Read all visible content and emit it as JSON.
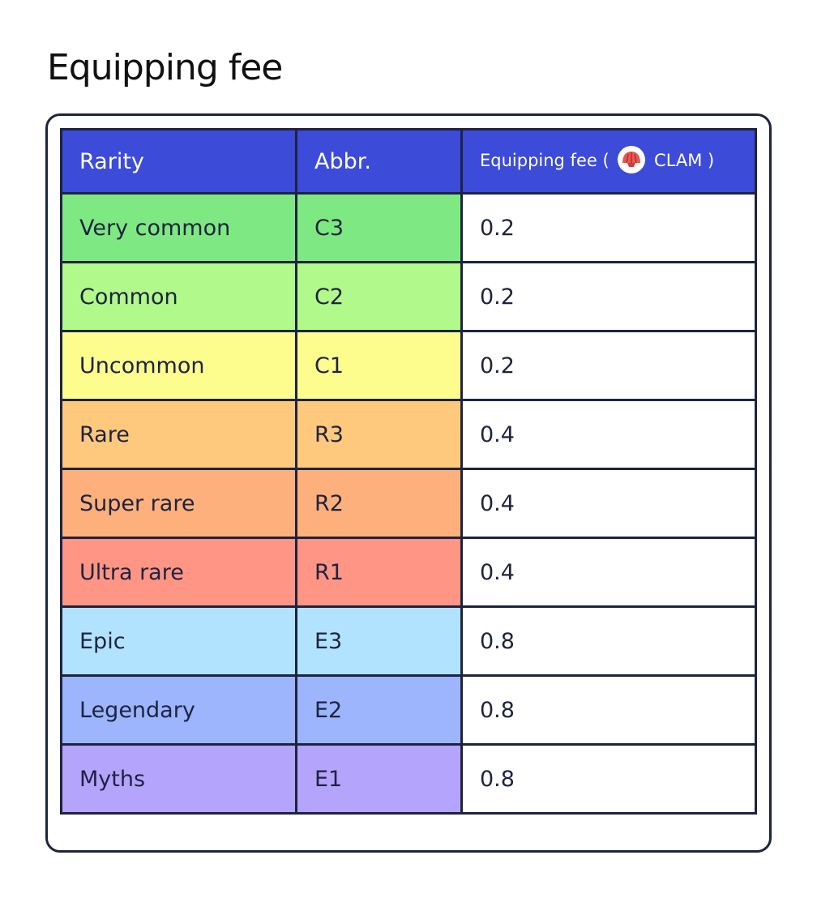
{
  "title": "Equipping fee",
  "table": {
    "headers": {
      "rarity": "Rarity",
      "abbr": "Abbr.",
      "fee_prefix": "Equipping fee (",
      "fee_currency": "CLAM )",
      "fee_icon": "clam-shell-icon"
    },
    "rows": [
      {
        "rarity": "Very common",
        "abbr": "C3",
        "fee": "0.2",
        "color": "#7ee982"
      },
      {
        "rarity": "Common",
        "abbr": "C2",
        "fee": "0.2",
        "color": "#b1f98a"
      },
      {
        "rarity": "Uncommon",
        "abbr": "C1",
        "fee": "0.2",
        "color": "#fdfd8e"
      },
      {
        "rarity": "Rare",
        "abbr": "R3",
        "fee": "0.4",
        "color": "#fec97c"
      },
      {
        "rarity": "Super rare",
        "abbr": "R2",
        "fee": "0.4",
        "color": "#fdb07c"
      },
      {
        "rarity": "Ultra rare",
        "abbr": "R1",
        "fee": "0.4",
        "color": "#fe9585"
      },
      {
        "rarity": "Epic",
        "abbr": "E3",
        "fee": "0.8",
        "color": "#b2e3fe"
      },
      {
        "rarity": "Legendary",
        "abbr": "E2",
        "fee": "0.8",
        "color": "#9cb5fc"
      },
      {
        "rarity": "Myths",
        "abbr": "E1",
        "fee": "0.8",
        "color": "#b4a4fc"
      }
    ]
  },
  "colors": {
    "header_bg": "#3c4bd8",
    "border": "#1e2340",
    "clam_shell": "#e8584f"
  }
}
